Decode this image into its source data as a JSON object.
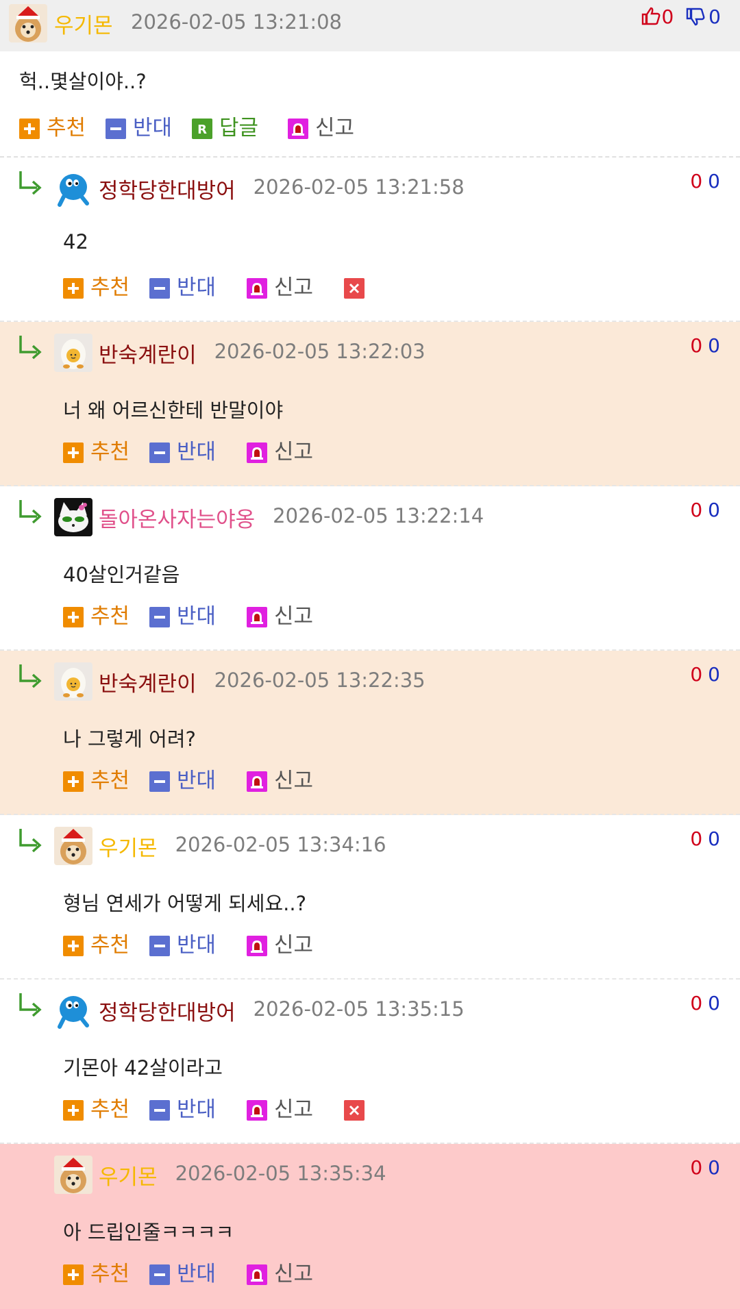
{
  "top": {
    "nick": "우기몬",
    "nick_color": "#f5b800",
    "date": "2026-02-05 13:21:08",
    "text": "헉..몇살이야..?",
    "up": "0",
    "down": "0",
    "actions": {
      "recommend": "추천",
      "oppose": "반대",
      "reply": "답글",
      "report": "신고"
    }
  },
  "replies": [
    {
      "nick": "정학당한대방어",
      "nick_color": "#8a0f0f",
      "date": "2026-02-05 13:21:58",
      "text": "42",
      "up": "0",
      "down": "0",
      "recommend": "추천",
      "oppose": "반대",
      "report": "신고"
    },
    {
      "nick": "반숙계란이",
      "nick_color": "#8a0f0f",
      "date": "2026-02-05 13:22:03",
      "text": "너 왜 어르신한테 반말이야",
      "up": "0",
      "down": "0",
      "recommend": "추천",
      "oppose": "반대",
      "report": "신고"
    },
    {
      "nick": "돌아온사자는야옹",
      "nick_color": "#e0508a",
      "date": "2026-02-05 13:22:14",
      "text": "40살인거같음",
      "up": "0",
      "down": "0",
      "recommend": "추천",
      "oppose": "반대",
      "report": "신고"
    },
    {
      "nick": "반숙계란이",
      "nick_color": "#8a0f0f",
      "date": "2026-02-05 13:22:35",
      "text": "나 그렇게 어려?",
      "up": "0",
      "down": "0",
      "recommend": "추천",
      "oppose": "반대",
      "report": "신고"
    },
    {
      "nick": "우기몬",
      "nick_color": "#f5b800",
      "date": "2026-02-05 13:34:16",
      "text": "형님 연세가 어떻게 되세요..?",
      "up": "0",
      "down": "0",
      "recommend": "추천",
      "oppose": "반대",
      "report": "신고"
    },
    {
      "nick": "정학당한대방어",
      "nick_color": "#8a0f0f",
      "date": "2026-02-05 13:35:15",
      "text": "기몬아 42살이라고",
      "up": "0",
      "down": "0",
      "recommend": "추천",
      "oppose": "반대",
      "report": "신고"
    },
    {
      "nick": "우기몬",
      "nick_color": "#f5b800",
      "date": "2026-02-05 13:35:34",
      "text": "아 드립인줄ㅋㅋㅋㅋ",
      "up": "0",
      "down": "0",
      "recommend": "추천",
      "oppose": "반대",
      "report": "신고"
    }
  ],
  "colors": {
    "peach_bg": "#fbe9d8",
    "pink_bg": "#fdcaca",
    "upvote": "#d0021b",
    "downvote": "#1a2fbf"
  }
}
